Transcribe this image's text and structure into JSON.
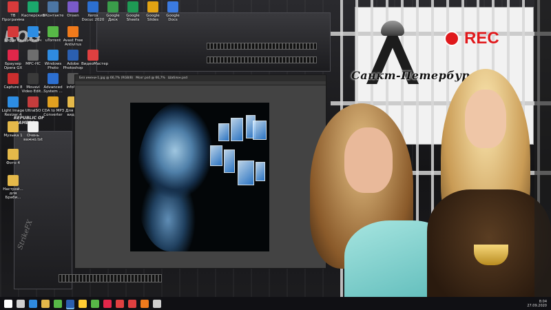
{
  "desktop": {
    "icons": [
      {
        "label": "ТВ Программа",
        "glyph": "tv-icon",
        "color": "#d93b3b"
      },
      {
        "label": "Касперский",
        "glyph": "shield-icon",
        "color": "#1ba86c"
      },
      {
        "label": "ВКонтакте",
        "glyph": "vk-icon",
        "color": "#4c75a3"
      },
      {
        "label": "Onsen",
        "glyph": "app-icon",
        "color": "#7a5ac9"
      },
      {
        "label": "Xerox Docuc 2020",
        "glyph": "doc-icon",
        "color": "#2c6fd1"
      },
      {
        "label": "Google Диск",
        "glyph": "drive-icon",
        "color": "#3a9d4a"
      },
      {
        "label": "Google Sheets",
        "glyph": "sheets-icon",
        "color": "#1e9a54"
      },
      {
        "label": "Google Slides",
        "glyph": "slides-icon",
        "color": "#e2a313"
      },
      {
        "label": "Google Docs",
        "glyph": "docs-icon",
        "color": "#3b7ae0"
      },
      {
        "label": "Rogue Ex",
        "glyph": "app-icon",
        "color": "#d43a3a"
      },
      {
        "label": "Диспетч",
        "glyph": "app-icon",
        "color": "#2d8de3"
      },
      {
        "label": "uTorrent",
        "glyph": "torrent-icon",
        "color": "#57b847"
      },
      {
        "label": "Avast Free Antivirus",
        "glyph": "avast-icon",
        "color": "#f07a1c"
      },
      {
        "label": "Браузер Opera GX",
        "glyph": "opera-icon",
        "color": "#e2274a"
      },
      {
        "label": "MPC-HC",
        "glyph": "player-icon",
        "color": "#6e6e6e"
      },
      {
        "label": "Windows Photo",
        "glyph": "photo-icon",
        "color": "#2f8be0"
      },
      {
        "label": "Adobe Photoshop",
        "glyph": "ps-icon",
        "color": "#2b5fb0"
      },
      {
        "label": "ВидеоМастер",
        "glyph": "video-icon",
        "color": "#e04040"
      },
      {
        "label": "Capture 8",
        "glyph": "capture-icon",
        "color": "#cc2e2e"
      },
      {
        "label": "Movavi Video Edit...",
        "glyph": "movavi-icon",
        "color": "#3a3a3a"
      },
      {
        "label": "Advanced System ...",
        "glyph": "asc-icon",
        "color": "#2c6fd1"
      },
      {
        "label": "infoWA",
        "glyph": "app-icon",
        "color": "#555"
      },
      {
        "label": "Light Image Resizer 4",
        "glyph": "resize-icon",
        "color": "#2d8de3"
      },
      {
        "label": "UltraISO",
        "glyph": "disc-icon",
        "color": "#c43c3c"
      },
      {
        "label": "CDA to MP3 Converter",
        "glyph": "music-icon",
        "color": "#e0a020"
      },
      {
        "label": "Для В... видео",
        "glyph": "folder-icon",
        "color": "#e5b94a"
      },
      {
        "label": "Музыка 1",
        "glyph": "folder-icon",
        "color": "#e5b94a"
      },
      {
        "label": "Очень важно.txt",
        "glyph": "text-file-icon",
        "color": "#f0f0f0"
      },
      {
        "label": "Фото 4",
        "glyph": "folder-icon",
        "color": "#e5b94a"
      },
      {
        "label": "Настрой... для Браби...",
        "glyph": "folder-icon",
        "color": "#e5b94a"
      }
    ]
  },
  "photoshop": {
    "tabs": [
      "Без имени-1.jpg @ 66,7% (RGB/8)",
      "Мозг.psd @ 66,7%",
      "Шаблон.psd"
    ]
  },
  "overlay": {
    "city_title": "Санкт-Петербург",
    "rec_label": "REC"
  },
  "branding": {
    "rog_big": "REPUBLIC OF",
    "rog_small": "GAMERS",
    "strike": "StrikeFX"
  },
  "taskbar": {
    "apps": [
      {
        "name": "start-icon",
        "color": "#ffffff"
      },
      {
        "name": "search-icon",
        "color": "#cfcfcf"
      },
      {
        "name": "edge-icon",
        "color": "#2f8be0"
      },
      {
        "name": "explorer-icon",
        "color": "#e5b94a"
      },
      {
        "name": "capture-icon",
        "color": "#57b847"
      },
      {
        "name": "photoshop-icon",
        "color": "#2b5fb0",
        "active": true
      },
      {
        "name": "chrome-icon",
        "color": "#ffcc33"
      },
      {
        "name": "torrent-icon",
        "color": "#57b847"
      },
      {
        "name": "opera-icon",
        "color": "#e2274a"
      },
      {
        "name": "player-icon",
        "color": "#e04040"
      },
      {
        "name": "video-icon",
        "color": "#e04040"
      },
      {
        "name": "avast-icon",
        "color": "#f07a1c"
      },
      {
        "name": "mail-icon",
        "color": "#cfcfcf"
      }
    ],
    "clock": "8:04",
    "date": "27.09.2020"
  }
}
